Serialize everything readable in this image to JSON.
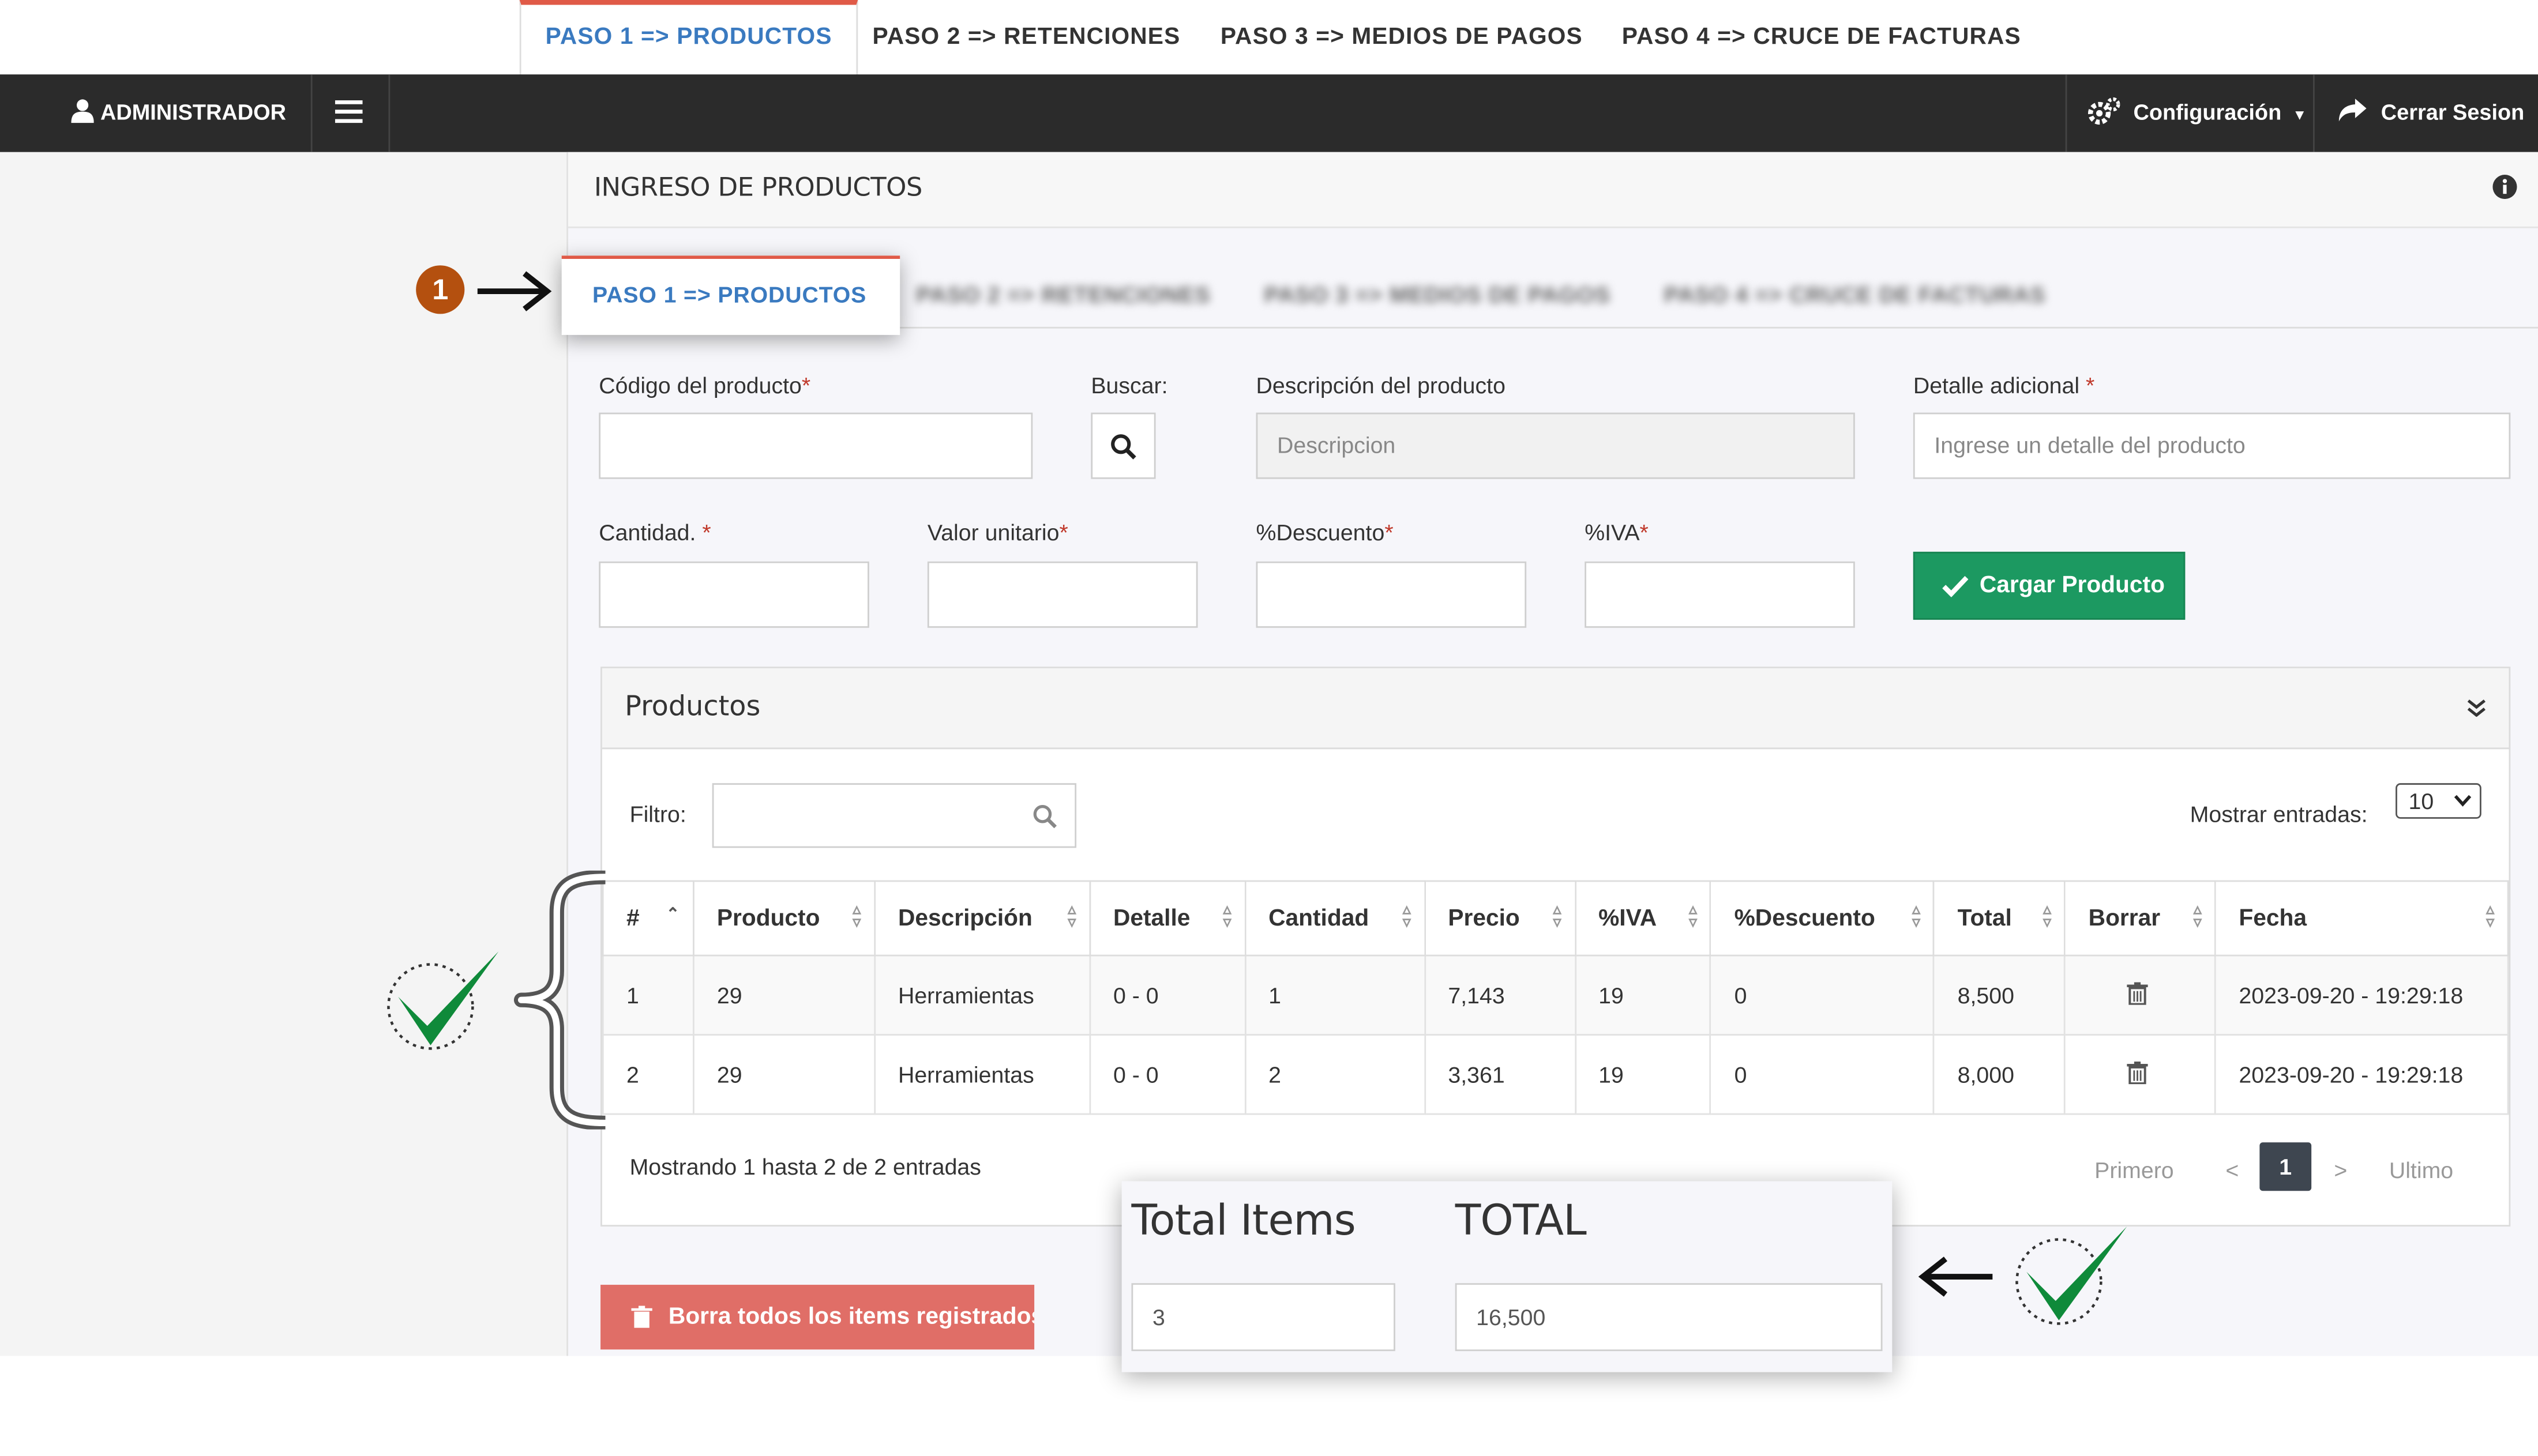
{
  "top_tabs": [
    {
      "label": "PASO 1 => PRODUCTOS"
    },
    {
      "label": "PASO 2 => RETENCIONES"
    },
    {
      "label": "PASO 3 => MEDIOS DE PAGOS"
    },
    {
      "label": "PASO 4 => CRUCE DE FACTURAS"
    }
  ],
  "navbar": {
    "user": "ADMINISTRADOR",
    "config": "Configuración",
    "logout": "Cerrar Sesion"
  },
  "panel": {
    "title": "INGRESO DE PRODUCTOS",
    "step_marker": "1",
    "tabs": [
      {
        "label": "PASO 1 => PRODUCTOS"
      },
      {
        "label": "PASO 2 => RETENCIONES"
      },
      {
        "label": "PASO 3 => MEDIOS DE PAGOS"
      },
      {
        "label": "PASO 4 => CRUCE DE FACTURAS"
      }
    ]
  },
  "form": {
    "codigo_label": "Código del producto",
    "buscar_label": "Buscar:",
    "descripcion_label": "Descripción del producto",
    "descripcion_placeholder": "Descripcion",
    "detalle_label": "Detalle adicional",
    "detalle_placeholder": "Ingrese un detalle del producto",
    "cantidad_label": "Cantidad.",
    "valor_label": "Valor unitario",
    "descuento_label": "%Descuento",
    "iva_label": "%IVA",
    "required_mark": "*",
    "submit_label": "Cargar Producto"
  },
  "productos": {
    "title": "Productos",
    "filter_label": "Filtro:",
    "show_label": "Mostrar entradas:",
    "show_value": "10",
    "columns": [
      "#",
      "Producto",
      "Descripción",
      "Detalle",
      "Cantidad",
      "Precio",
      "%IVA",
      "%Descuento",
      "Total",
      "Borrar",
      "Fecha"
    ],
    "rows": [
      [
        "1",
        "29",
        "Herramientas",
        "0 - 0",
        "1",
        "7,143",
        "19",
        "0",
        "8,500",
        "",
        "2023-09-20 - 19:29:18"
      ],
      [
        "2",
        "29",
        "Herramientas",
        "0 - 0",
        "2",
        "3,361",
        "19",
        "0",
        "8,000",
        "",
        "2023-09-20 - 19:29:18"
      ]
    ],
    "info": "Mostrando 1 hasta 2 de 2 entradas",
    "pager": {
      "first": "Primero",
      "prev": "<",
      "current": "1",
      "next": ">",
      "last": "Ultimo"
    }
  },
  "delete_all_label": "Borra todos los items registrados",
  "totals": {
    "items_label": "Total Items",
    "items_value": "3",
    "total_label": "TOTAL",
    "total_value": "16,500"
  },
  "colors": {
    "accent_blue": "#3a7ac0",
    "tab_red": "#e05a47",
    "nav_dark": "#2b2b2b",
    "green": "#1c9961",
    "red_button": "#e06e67",
    "marker_orange": "#b4500f",
    "check_green": "#0f8a3a"
  }
}
